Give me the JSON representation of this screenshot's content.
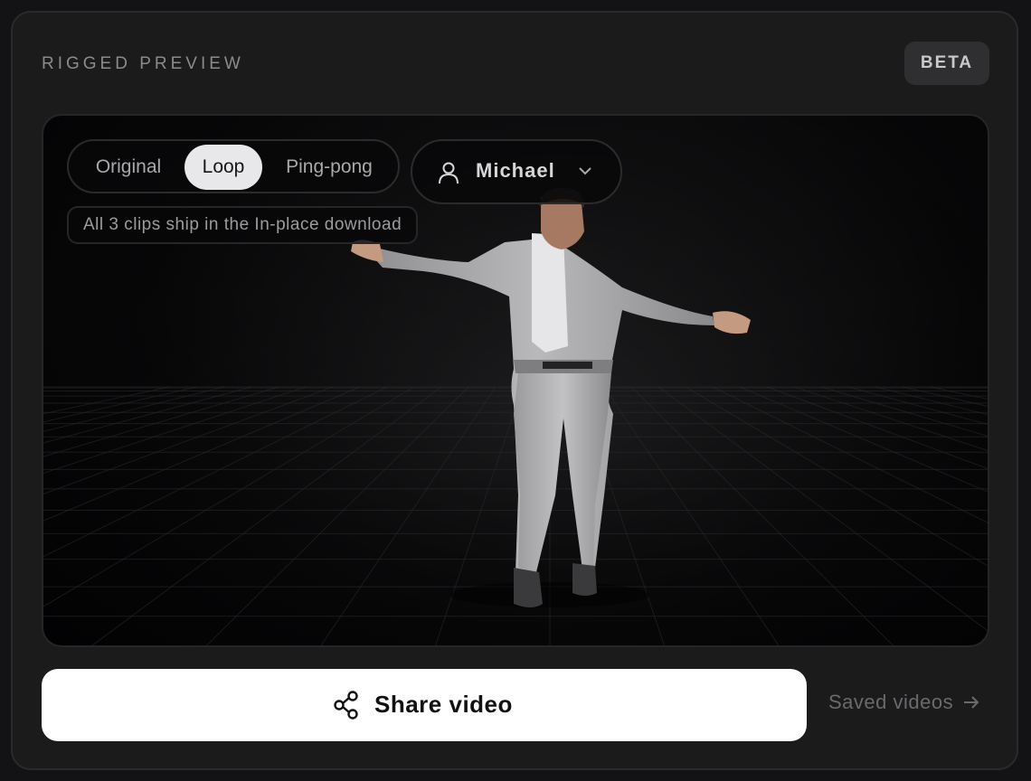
{
  "header": {
    "title": "RIGGED PREVIEW",
    "badge": "BETA"
  },
  "viewport": {
    "modes": [
      {
        "label": "Original",
        "active": false
      },
      {
        "label": "Loop",
        "active": true
      },
      {
        "label": "Ping-pong",
        "active": false
      }
    ],
    "character": {
      "name": "Michael",
      "icon": "user-icon"
    },
    "clips_note": "All 3 clips ship in the In-place download"
  },
  "actions": {
    "share_label": "Share video",
    "share_icon": "share-icon",
    "saved_label": "Saved videos",
    "saved_icon": "arrow-right-icon"
  },
  "colors": {
    "background": "#131315",
    "card": "#1b1b1c",
    "primary_button": "#ffffff",
    "active_toggle": "#e8e8ea",
    "muted_text": "#8b8b8e"
  }
}
